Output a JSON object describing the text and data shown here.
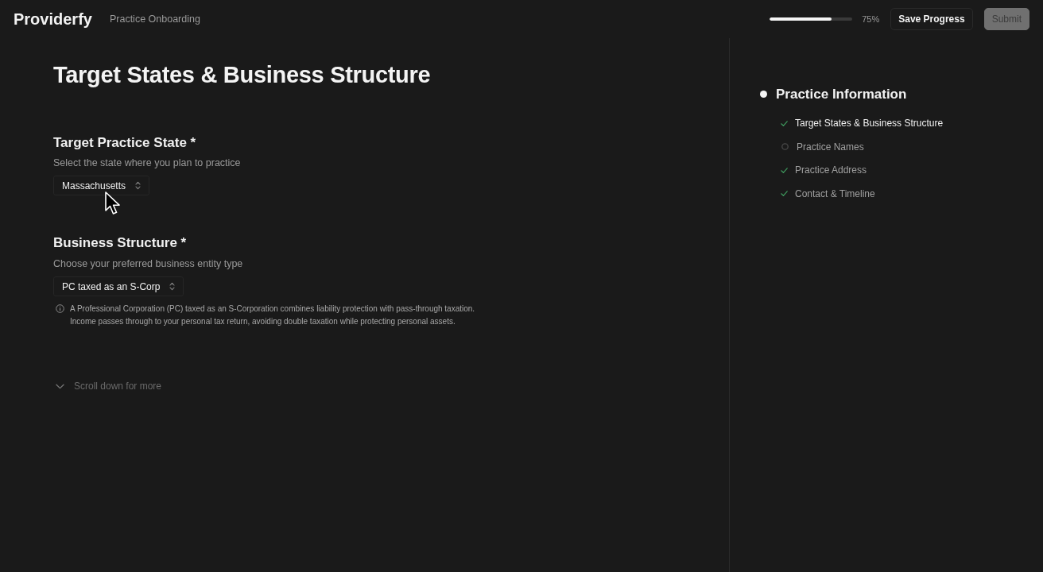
{
  "header": {
    "brand": "Providerfy",
    "subtitle": "Practice Onboarding",
    "progress": {
      "level": 0.75,
      "reading": "75%"
    },
    "buttons": [
      {
        "label": "Save Progress",
        "kind": "secondary",
        "disabled": false
      },
      {
        "label": "Submit",
        "kind": "primary",
        "disabled": true
      }
    ]
  },
  "page": {
    "title": "Target States & Business Structure"
  },
  "sections": [
    {
      "heading": "Target Practice State *",
      "description": "Select the state where you plan to practice",
      "select": {
        "value": "Massachusetts"
      }
    },
    {
      "heading": "Business Structure *",
      "description": "Choose your preferred business entity type",
      "select": {
        "value": "PC taxed as an S-Corp"
      },
      "note": "A Professional Corporation (PC) taxed as an S-Corporation combines liability protection with pass-through taxation. Income passes through to your personal tax return, avoiding double taxation while protecting personal assets."
    }
  ],
  "scroll_hint": "Scroll down for more",
  "sidebar": {
    "title": "Practice Information",
    "steps": [
      {
        "label": "Target States & Business Structure",
        "completed": true,
        "selected": true
      },
      {
        "label": "Practice Names",
        "completed": false,
        "selected": false
      },
      {
        "label": "Practice Address",
        "completed": true,
        "selected": false
      },
      {
        "label": "Contact & Timeline",
        "completed": true,
        "selected": false
      }
    ]
  }
}
